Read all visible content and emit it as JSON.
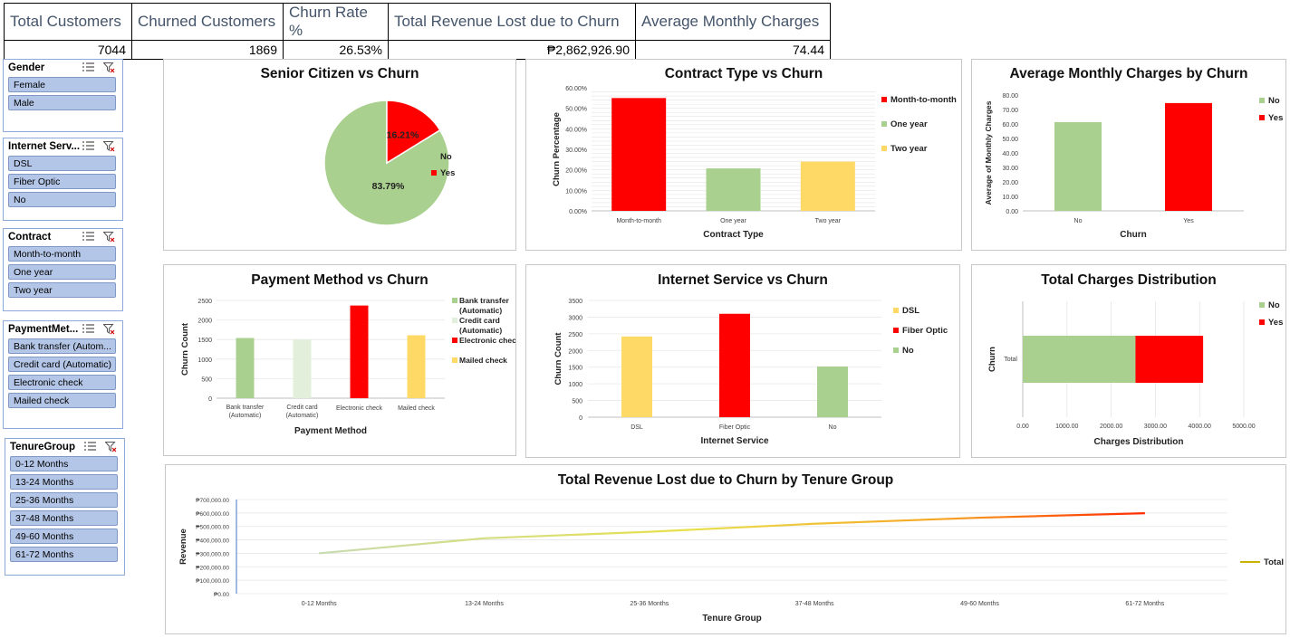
{
  "kpi": {
    "headers": [
      "Total Customers",
      "Churned Customers",
      "Churn Rate %",
      "Total Revenue Lost due to Churn",
      "Average Monthly Charges"
    ],
    "values": [
      "7044",
      "1869",
      "26.53%",
      "2,862,926.90",
      "74.44"
    ],
    "currency_symbol": "₱"
  },
  "slicers": {
    "gender": {
      "title": "Gender",
      "items": [
        "Female",
        "Male"
      ]
    },
    "internet": {
      "title": "Internet Serv...",
      "items": [
        "DSL",
        "Fiber Optic",
        "No"
      ]
    },
    "contract": {
      "title": "Contract",
      "items": [
        "Month-to-month",
        "One year",
        "Two year"
      ]
    },
    "payment": {
      "title": "PaymentMet...",
      "items": [
        "Bank transfer (Autom...",
        "Credit card (Automatic)",
        "Electronic check",
        "Mailed check"
      ]
    },
    "tenure": {
      "title": "TenureGroup",
      "items": [
        "0-12 Months",
        "13-24 Months",
        "25-36 Months",
        "37-48 Months",
        "49-60 Months",
        "61-72 Months"
      ]
    }
  },
  "colors": {
    "no": "#a9d08e",
    "yes": "#ff0000",
    "two_year": "#ffd966",
    "credit": "#e2efda",
    "mailed": "#ffd966",
    "dsl": "#ffd966",
    "fiber": "#ff0000",
    "no_internet": "#a9d08e"
  },
  "chart_data": [
    {
      "id": "senior",
      "type": "pie",
      "title": "Senior Citizen vs Churn",
      "slices": [
        {
          "name": "No",
          "value": 83.79,
          "label": "83.79%",
          "color": "#a9d08e"
        },
        {
          "name": "Yes",
          "value": 16.21,
          "label": "16.21%",
          "color": "#ff0000"
        }
      ],
      "legend": [
        "No",
        "Yes"
      ],
      "legend_position": "right"
    },
    {
      "id": "contract",
      "type": "bar",
      "title": "Contract Type vs Churn",
      "categories": [
        "Month-to-month",
        "One year",
        "Two year"
      ],
      "values": [
        0.55,
        0.207,
        0.24
      ],
      "colors": [
        "#ff0000",
        "#a9d08e",
        "#ffd966"
      ],
      "xlabel": "Contract Type",
      "ylabel": "Churn Percentage",
      "ylim": [
        0,
        0.6
      ],
      "ticks": [
        "0.00%",
        "10.00%",
        "20.00%",
        "30.00%",
        "40.00%",
        "50.00%",
        "60.00%"
      ],
      "legend": [
        "Month-to-month",
        "One year",
        "Two year"
      ],
      "grid": true
    },
    {
      "id": "avgmonthly",
      "type": "bar",
      "title": "Average Monthly Charges by Churn",
      "categories": [
        "No",
        "Yes"
      ],
      "values": [
        61.3,
        74.44
      ],
      "colors": [
        "#a9d08e",
        "#ff0000"
      ],
      "xlabel": "Churn",
      "ylabel": "Average of Monthly Charges",
      "ylim": [
        0,
        80
      ],
      "ticks": [
        "0.00",
        "10.00",
        "20.00",
        "30.00",
        "40.00",
        "50.00",
        "60.00",
        "70.00",
        "80.00"
      ],
      "legend": [
        "No",
        "Yes"
      ]
    },
    {
      "id": "payment",
      "type": "bar",
      "title": "Payment Method vs Churn",
      "categories": [
        "Bank transfer (Automatic)",
        "Credit card (Automatic)",
        "Electronic check",
        "Mailed check"
      ],
      "values": [
        1540,
        1500,
        2370,
        1610
      ],
      "colors": [
        "#a9d08e",
        "#e2efda",
        "#ff0000",
        "#ffd966"
      ],
      "xlabel": "Payment Method",
      "ylabel": "Churn Count",
      "ylim": [
        0,
        2500
      ],
      "ticks": [
        "0",
        "500",
        "1000",
        "1500",
        "2000",
        "2500"
      ],
      "legend": [
        "Bank transfer (Automatic)",
        "Credit card (Automatic)",
        "Electronic check",
        "Mailed check"
      ]
    },
    {
      "id": "internet",
      "type": "bar",
      "title": "Internet Service vs Churn",
      "categories": [
        "DSL",
        "Fiber Optic",
        "No"
      ],
      "values": [
        2420,
        3100,
        1520
      ],
      "colors": [
        "#ffd966",
        "#ff0000",
        "#a9d08e"
      ],
      "xlabel": "Internet Service",
      "ylabel": "Churn Count",
      "ylim": [
        0,
        3500
      ],
      "ticks": [
        "0",
        "500",
        "1000",
        "1500",
        "2000",
        "2500",
        "3000",
        "3500"
      ],
      "legend": [
        "DSL",
        "Fiber Optic",
        "No"
      ]
    },
    {
      "id": "totalcharges",
      "type": "bar",
      "title": "Total Charges Distribution",
      "categories": [
        "Total"
      ],
      "series": [
        {
          "name": "No",
          "values": [
            2550
          ]
        },
        {
          "name": "Yes",
          "values": [
            1530
          ]
        }
      ],
      "colors": [
        "#a9d08e",
        "#ff0000"
      ],
      "orientation": "horizontal",
      "stacked": true,
      "xlabel": "Charges Distribution",
      "ylabel": "Churn",
      "xlim": [
        0,
        5000
      ],
      "ticks": [
        "0.00",
        "1000.00",
        "2000.00",
        "3000.00",
        "4000.00",
        "5000.00"
      ],
      "legend": [
        "No",
        "Yes"
      ]
    },
    {
      "id": "revenue",
      "type": "line",
      "title": "Total Revenue Lost due to Churn by Tenure Group",
      "categories": [
        "0-12 Months",
        "13-24 Months",
        "25-36 Months",
        "37-48 Months",
        "49-60 Months",
        "61-72 Months"
      ],
      "series": [
        {
          "name": "Total",
          "values": [
            300000,
            412000,
            460000,
            520000,
            565000,
            598000
          ]
        }
      ],
      "xlabel": "Tenure Group",
      "ylabel": "Revenue",
      "ylim": [
        0,
        700000
      ],
      "ticks": [
        "₱0.00",
        "₱100,000.00",
        "₱200,000.00",
        "₱300,000.00",
        "₱400,000.00",
        "₱500,000.00",
        "₱600,000.00",
        "₱700,000.00"
      ],
      "legend": [
        "Total"
      ]
    }
  ]
}
